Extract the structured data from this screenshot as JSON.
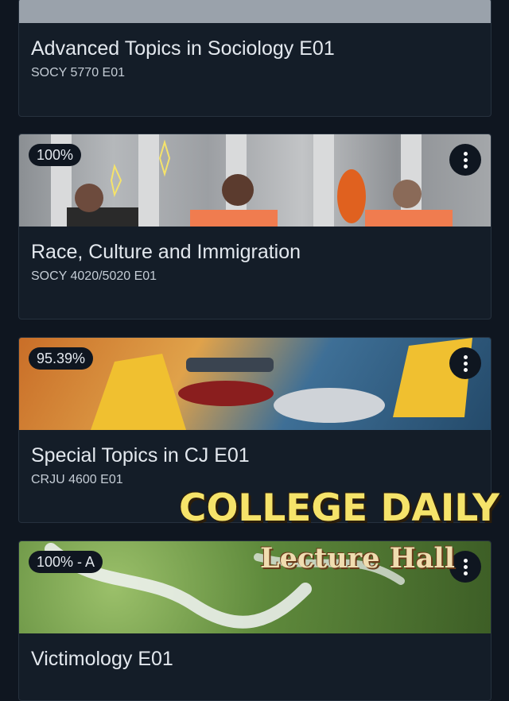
{
  "courses": [
    {
      "title": "Advanced Topics in Sociology E01",
      "code": "SOCY 5770 E01",
      "grade": ""
    },
    {
      "title": "Race, Culture and Immigration",
      "code": "SOCY 4020/5020 E01",
      "grade": "100%"
    },
    {
      "title": "Special Topics in CJ E01",
      "code": "CRJU 4600 E01",
      "grade": "95.39%"
    },
    {
      "title": "Victimology E01",
      "code": "",
      "grade": "100% - A"
    }
  ],
  "overlay": {
    "title": "COLLEGE DAILY",
    "subtitle": "Lecture Hall"
  },
  "colors": {
    "background": "#0f1620",
    "card": "#141d28",
    "overlay_title": "#f5e36a"
  },
  "icons": [
    "more-options-icon"
  ]
}
